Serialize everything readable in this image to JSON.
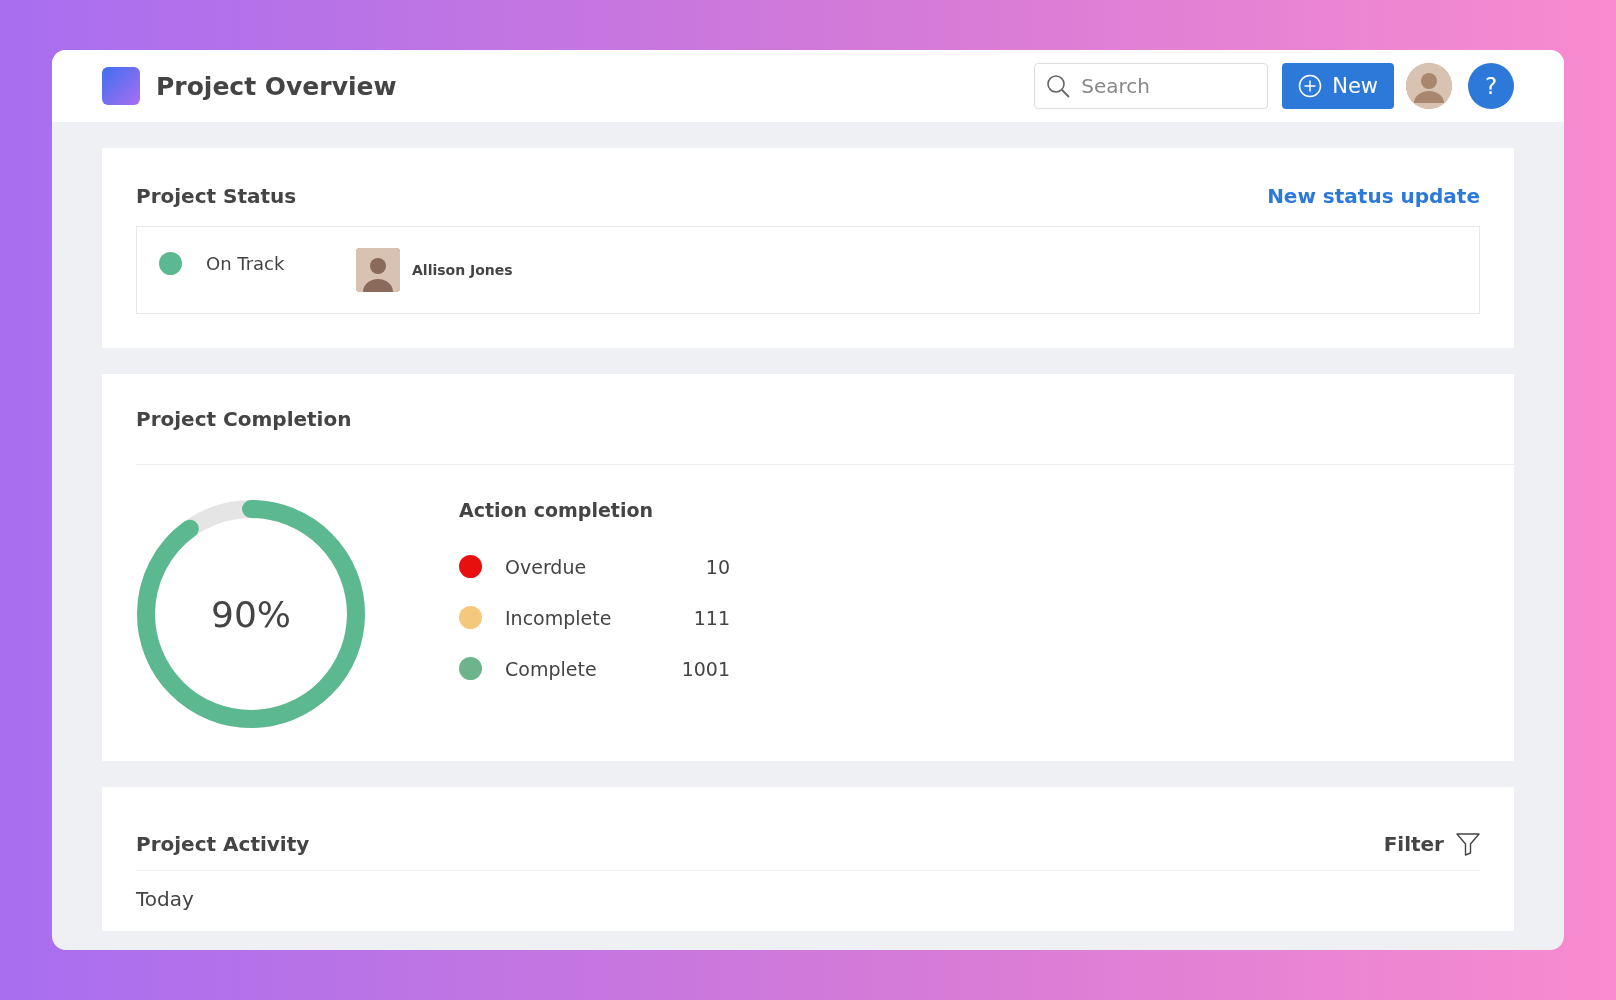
{
  "header": {
    "title": "Project Overview",
    "search": {
      "placeholder": "Search"
    },
    "new_button": "New",
    "help_button": "?"
  },
  "status_card": {
    "title": "Project Status",
    "link": "New status update",
    "status": {
      "label": "On Track",
      "color": "#5cb88f"
    },
    "owner": "Allison Jones"
  },
  "completion_card": {
    "title": "Project Completion",
    "progress": {
      "level": 0.9,
      "reading": "90%"
    },
    "legend_title": "Action completion",
    "legend": [
      {
        "label": "Overdue",
        "count": "10",
        "color": "#e8100f"
      },
      {
        "label": "Incomplete",
        "count": "111",
        "color": "#f5c97d"
      },
      {
        "label": "Complete",
        "count": "1001",
        "color": "#6db38b"
      }
    ]
  },
  "activity_card": {
    "title": "Project Activity",
    "filter": "Filter",
    "group": "Today"
  }
}
